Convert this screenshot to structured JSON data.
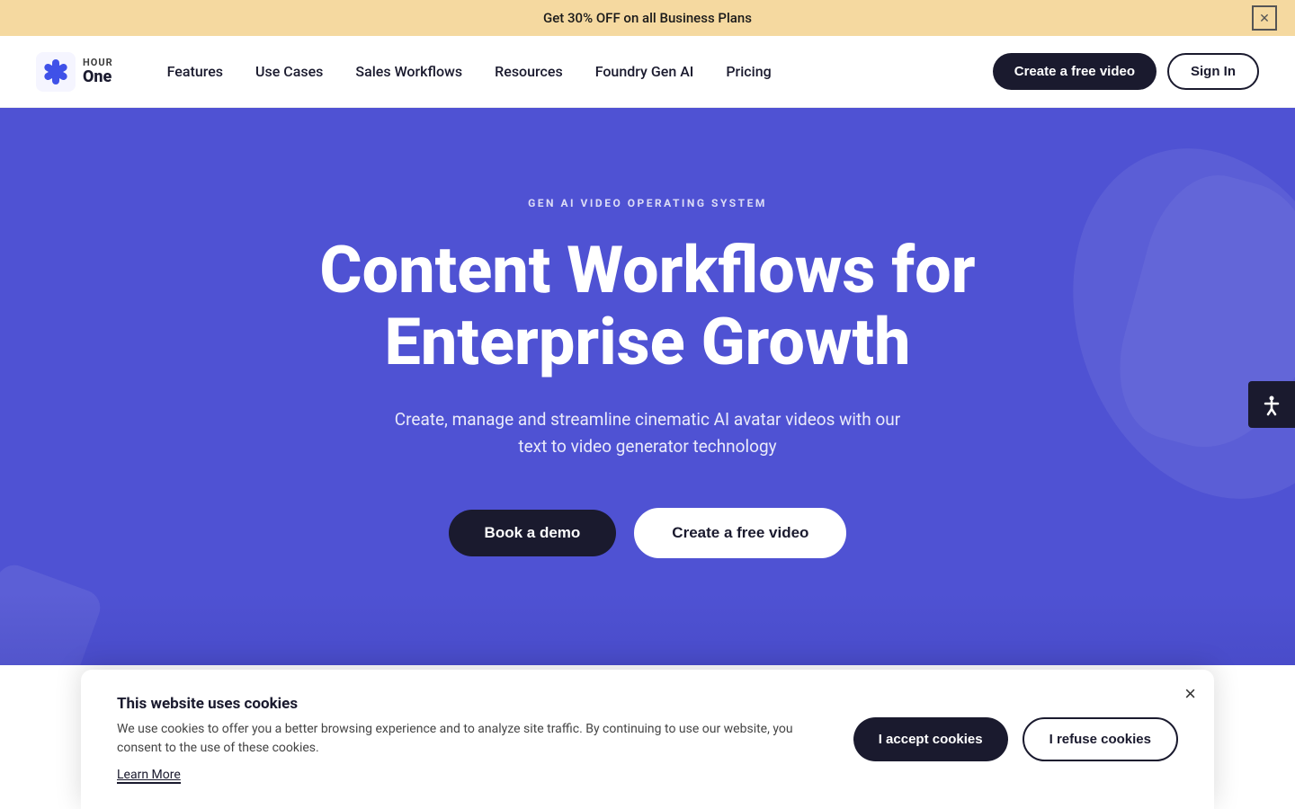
{
  "banner": {
    "text": "Get 30% OFF on all Business Plans",
    "close_label": "✕"
  },
  "navbar": {
    "logo_line1": "HOUR",
    "logo_line2": "One",
    "links": [
      {
        "label": "Features",
        "id": "features"
      },
      {
        "label": "Use Cases",
        "id": "use-cases"
      },
      {
        "label": "Sales Workflows",
        "id": "sales-workflows"
      },
      {
        "label": "Resources",
        "id": "resources"
      },
      {
        "label": "Foundry Gen AI",
        "id": "foundry-gen-ai"
      },
      {
        "label": "Pricing",
        "id": "pricing"
      }
    ],
    "create_btn": "Create a free video",
    "signin_btn": "Sign In"
  },
  "hero": {
    "badge": "GEN AI VIDEO OPERATING SYSTEM",
    "title": "Content Workflows for Enterprise Growth",
    "subtitle": "Create, manage and streamline cinematic AI avatar videos with our text to video generator technology",
    "book_demo_btn": "Book a demo",
    "create_free_btn": "Create a free video"
  },
  "accessibility": {
    "icon": "☿",
    "label": "Accessibility"
  },
  "cookie": {
    "title": "This website uses cookies",
    "text": "We use cookies to offer you a better browsing experience and to analyze site traffic. By continuing to use our website, you consent to the use of these cookies.",
    "learn_more": "Learn More",
    "accept_btn": "I accept cookies",
    "refuse_btn": "I refuse cookies",
    "close_label": "×"
  }
}
